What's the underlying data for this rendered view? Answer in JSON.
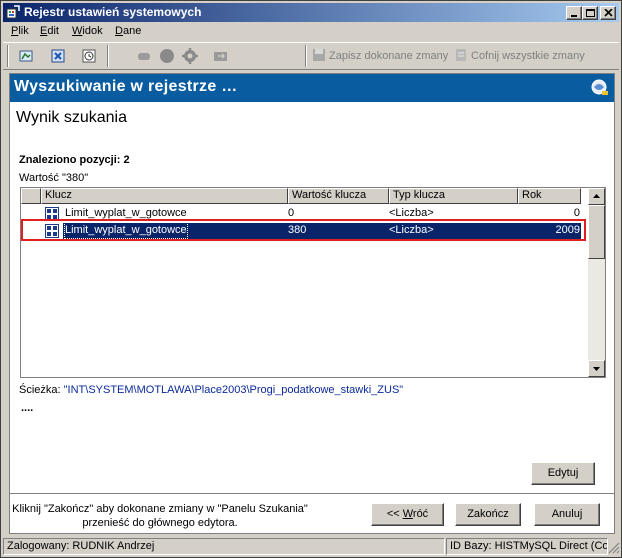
{
  "window": {
    "title": "Rejestr ustawień systemowych"
  },
  "menu": [
    {
      "label": "Plik",
      "key": "P",
      "rest": "lik"
    },
    {
      "label": "Edit",
      "key": "E",
      "rest": "dit"
    },
    {
      "label": "Widok",
      "key": "W",
      "rest": "idok"
    },
    {
      "label": "Dane",
      "key": "D",
      "rest": "ane"
    }
  ],
  "toolbar": {
    "save_label": "Zapisz dokonane zmany",
    "revert_label": "Cofnij wszystkie zmany"
  },
  "header": {
    "title": "Wyszukiwanie w rejestrze …"
  },
  "page": {
    "heading": "Wynik szukania",
    "found_label": "Znaleziono pozycji: 2",
    "value_label": "Wartość \"380\""
  },
  "grid": {
    "columns": [
      "Klucz",
      "Wartość klucza",
      "Typ klucza",
      "Rok"
    ],
    "rows": [
      {
        "key": "Limit_wyplat_w_gotowce",
        "value": "0",
        "type": "<Liczba>",
        "year": "0",
        "selected": false
      },
      {
        "key": "Limit_wyplat_w_gotowce",
        "value": "380",
        "type": "<Liczba>",
        "year": "2009",
        "selected": true
      }
    ]
  },
  "path": {
    "label": "Ścieżka:",
    "value": "\"INT\\SYSTEM\\MOTLAWA\\Place2003\\Progi_podatkowe_stawki_ZUS\""
  },
  "more": "....",
  "buttons": {
    "edit": "Edytuj",
    "back_prefix": "<< ",
    "back_key": "W",
    "back_rest": "róć",
    "finish": "Zakończ",
    "cancel": "Anuluj"
  },
  "hint": {
    "line1": "Kliknij \"Zakończ\" aby dokonane zmiany w \"Panelu Szukania\"",
    "line2": "przenieść do głównego edytora."
  },
  "status": {
    "user": "Zalogowany: RUDNIK Andrzej",
    "db": "ID Bazy: HISTMySQL Direct (Cor"
  },
  "colors": {
    "header_bg": "#0a5ca0",
    "selection_bg": "#0a246a",
    "highlight_border": "#e02020",
    "path_text": "#0a2a9a"
  }
}
